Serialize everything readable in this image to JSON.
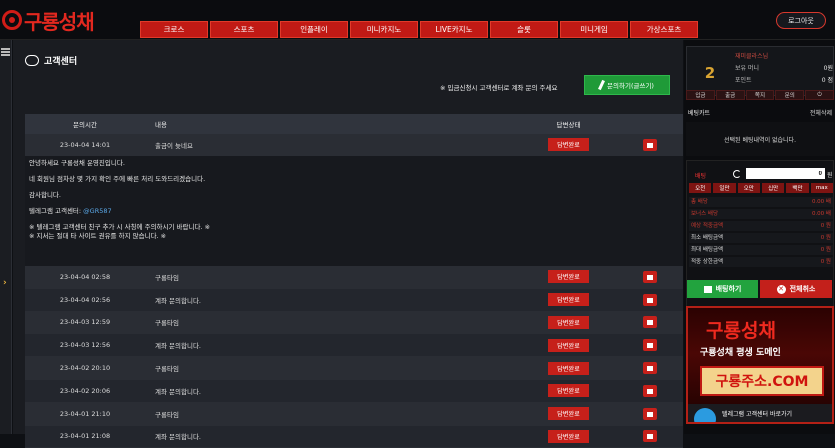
{
  "header": {
    "logo_text": "구룡성채",
    "nav": [
      "크로스",
      "스포츠",
      "인플레이",
      "미니카지노",
      "LIVE카지노",
      "슬롯",
      "미니게임",
      "가상스포츠"
    ],
    "login_label": "로그아웃"
  },
  "page": {
    "title": "고객센터",
    "notice": "※ 입금신청시 고객센터로 계좌 문의 주세요",
    "inquiry_button": "문의하기(글쓰기)"
  },
  "table": {
    "headers": {
      "time": "문의시간",
      "content": "내용",
      "status": "답변상태"
    },
    "expanded_row": {
      "time": "23-04-04 14:01",
      "content": "출금이 늦네요",
      "status": "답변완료"
    },
    "detail": {
      "line1": "안녕하세요 구룡성채 운영진입니다.",
      "line2": "네 회원님 점차상 몇 가지 확인 주에 빠른 처리 도와드리겠습니다.",
      "line3": "감사합니다.",
      "line4_prefix": "텔레그램 고객센터: ",
      "line4_id": "@GR587",
      "line5": "※ 텔레그램 고객센터 친구 추가 시 사칭에 주의하시기 바랍니다. ※",
      "line6": "※ 지서는 절대 타 사이트 권유를 하지 않습니다. ※"
    },
    "rows": [
      {
        "time": "23-04-04 02:58",
        "content": "구룡타임",
        "status": "답변완료"
      },
      {
        "time": "23-04-04 02:56",
        "content": "계좌 문의합니다.",
        "status": "답변완료"
      },
      {
        "time": "23-04-03 12:59",
        "content": "구룡타임",
        "status": "답변완료"
      },
      {
        "time": "23-04-03 12:56",
        "content": "계좌 문의합니다.",
        "status": "답변완료"
      },
      {
        "time": "23-04-02 20:10",
        "content": "구룡타임",
        "status": "답변완료"
      },
      {
        "time": "23-04-02 20:06",
        "content": "계좌 문의합니다.",
        "status": "답변완료"
      },
      {
        "time": "23-04-01 21:10",
        "content": "구룡타임",
        "status": "답변완료"
      },
      {
        "time": "23-04-01 21:08",
        "content": "계좌 문의합니다.",
        "status": "답변완료"
      }
    ]
  },
  "sidebar": {
    "profile": {
      "level": "2",
      "name": "재미클라스님",
      "money_label": "보유 머니",
      "money_value": "0원",
      "point_label": "포인트",
      "point_value": "0 점"
    },
    "quick": [
      "입금",
      "출금",
      "쪽지",
      "문의",
      ""
    ],
    "bet_cart_title": "베팅카트",
    "bet_cart_delete": "전체삭제",
    "bet_empty": "선택된 베팅내역이 없습니다.",
    "bet_label": "배팅",
    "bet_amount": "0",
    "won": "원",
    "amount_buttons": [
      "오천",
      "일만",
      "오만",
      "십만",
      "백만",
      "max"
    ],
    "stats": [
      {
        "k": "총 배당",
        "v": "0.00 배"
      },
      {
        "k": "보너스 배당",
        "v": "0.00 배"
      },
      {
        "k": "예상 적중금액",
        "v": "0 원"
      },
      {
        "k": "최소 배팅금액",
        "v": "0 원"
      },
      {
        "k": "최대 배팅금액",
        "v": "0 원"
      },
      {
        "k": "적중 상한금액",
        "v": "0 원"
      }
    ],
    "bet_button": "배팅하기",
    "cancel_button": "전체취소",
    "banner": {
      "logo": "구룡성채",
      "sub": "구룡성채 평생 도메인",
      "url": "구룡주소.COM",
      "tg_text": "텔레그램 고객센터 바로가기"
    }
  }
}
